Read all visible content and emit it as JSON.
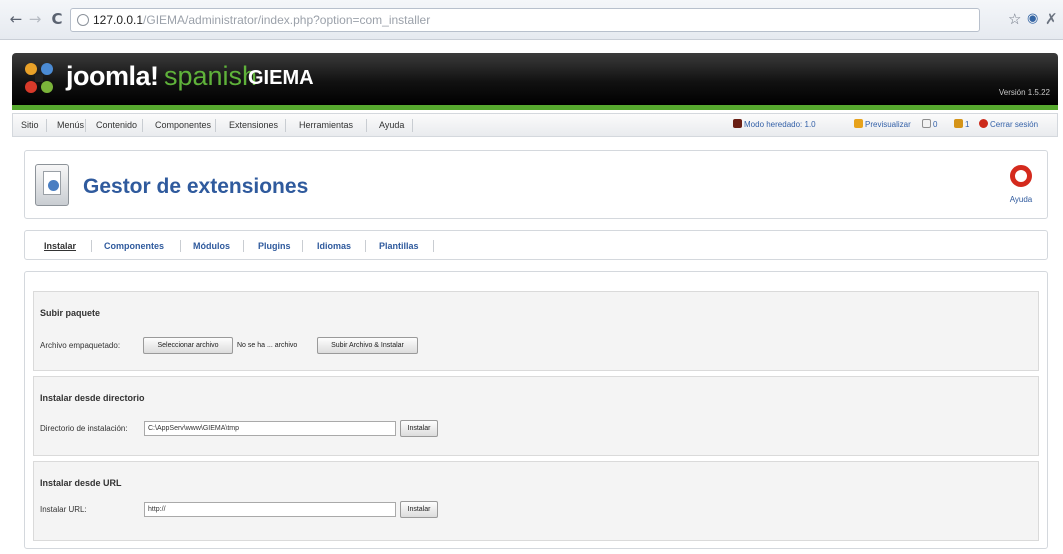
{
  "browser": {
    "url_host": "127.0.0.1",
    "url_path": "/GIEMA/administrator/index.php?option=com_installer"
  },
  "header": {
    "logo_text": "joomla!",
    "logo_language": "spanish",
    "site_name": "GIEMA",
    "version": "Versión 1.5.22"
  },
  "menu": {
    "items": [
      "Sitio",
      "Menús",
      "Contenido",
      "Componentes",
      "Extensiones",
      "Herramientas",
      "Ayuda"
    ]
  },
  "status": {
    "legacy": "Modo heredado: 1.0",
    "preview": "Previsualizar",
    "messages": "0",
    "users": "1",
    "logout": "Cerrar sesión"
  },
  "title": {
    "text": "Gestor de extensiones",
    "help": "Ayuda"
  },
  "submenu": {
    "items": [
      "Instalar",
      "Componentes",
      "Módulos",
      "Plugins",
      "Idiomas",
      "Plantillas"
    ]
  },
  "upload": {
    "title": "Subir paquete",
    "label": "Archivo empaquetado:",
    "choose_button": "Seleccionar archivo",
    "file_status": "No se ha ... archivo",
    "submit_button": "Subir Archivo & Instalar"
  },
  "directory": {
    "title": "Instalar desde directorio",
    "label": "Directorio de instalación:",
    "value": "C:\\AppServ\\www\\GIEMA\\tmp",
    "button": "Instalar"
  },
  "url": {
    "title": "Instalar desde URL",
    "label": "Instalar URL:",
    "value": "http://",
    "button": "Instalar"
  },
  "colors": {
    "joomla_green": "#56a82e",
    "link_blue": "#2f5a9d",
    "header_black": "#121212"
  }
}
